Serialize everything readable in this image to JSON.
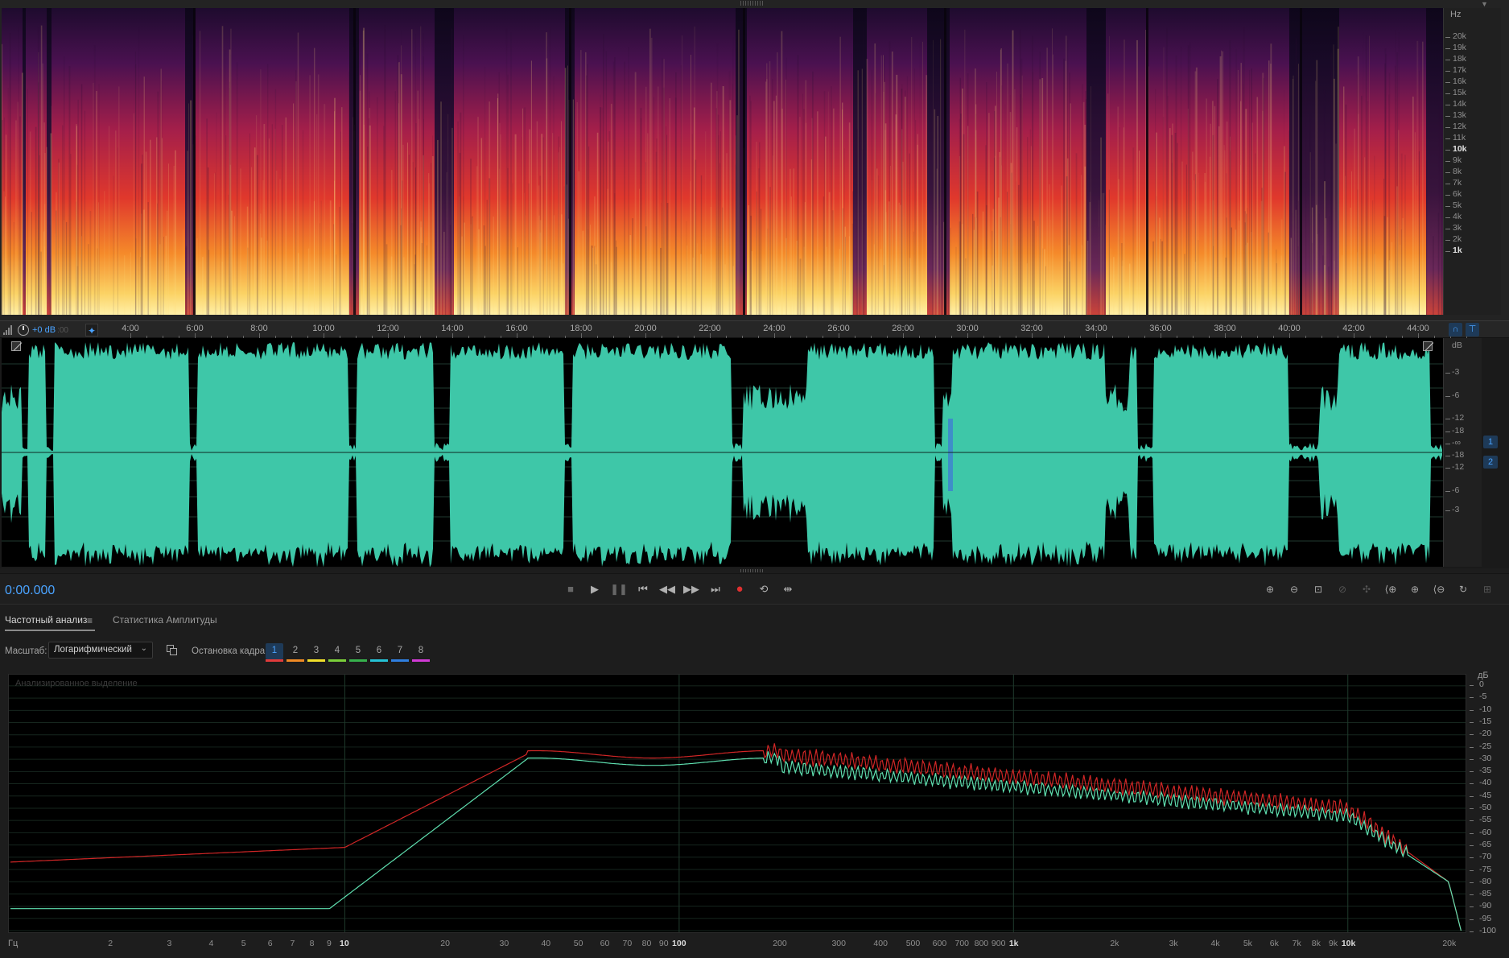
{
  "spectral": {
    "hz_unit": "Hz",
    "hz_labels": [
      "20k",
      "19k",
      "18k",
      "17k",
      "16k",
      "15k",
      "14k",
      "13k",
      "12k",
      "11k",
      "10k",
      "9k",
      "8k",
      "7k",
      "6k",
      "5k",
      "4k",
      "3k",
      "2k",
      "1k"
    ]
  },
  "time_ruler": {
    "gain_label": "+0 dB",
    "gain_ghost": ":00",
    "labels": [
      "4:00",
      "6:00",
      "8:00",
      "10:00",
      "12:00",
      "14:00",
      "16:00",
      "18:00",
      "20:00",
      "22:00",
      "24:00",
      "26:00",
      "28:00",
      "30:00",
      "32:00",
      "34:00",
      "36:00",
      "38:00",
      "40:00",
      "42:00",
      "44:00"
    ]
  },
  "waveform": {
    "db_unit": "dB",
    "db_labels": [
      "-3",
      "-6",
      "-12",
      "-18",
      "-∞",
      "-18",
      "-12",
      "-6",
      "-3"
    ],
    "channels": [
      "1",
      "2"
    ],
    "colors": {
      "wave": "#3ec7a8",
      "background": "#000000",
      "gap_highlight": "#3f7fd0"
    }
  },
  "transport": {
    "current_time": "0:00.000",
    "buttons": [
      "stop",
      "play",
      "pause",
      "go-to-start",
      "rewind",
      "fast-forward",
      "go-to-end",
      "record",
      "loop",
      "skip-selection"
    ],
    "zoom_buttons": [
      "zoom-in-amplitude",
      "zoom-out-amplitude",
      "zoom-to-selection",
      "zoom-out-full-disabled",
      "zoom-selection-disabled",
      "zoom-in-left",
      "zoom-in-time",
      "zoom-out-time",
      "zoom-full",
      "zoom-reset-disabled"
    ]
  },
  "analysis": {
    "tabs": [
      "Частотный анализ",
      "Статистика Амплитуды"
    ],
    "scale_label": "Масштаб:",
    "scale_value": "Логарифмический",
    "freeze_label": "Остановка кадра:",
    "frames": [
      "1",
      "2",
      "3",
      "4",
      "5",
      "6",
      "7",
      "8"
    ],
    "frame_colors": [
      "#e23b3b",
      "#f08a24",
      "#f2e02a",
      "#7bd03a",
      "#37b24d",
      "#25c3d6",
      "#2f7fe0",
      "#d23ad6"
    ],
    "plot_hint": "Анализированное выделение",
    "db_title": "дБ",
    "db_labels": [
      "0",
      "-5",
      "-10",
      "-15",
      "-20",
      "-25",
      "-30",
      "-35",
      "-40",
      "-45",
      "-50",
      "-55",
      "-60",
      "-65",
      "-70",
      "-75",
      "-80",
      "-85",
      "-90",
      "-95",
      "-100"
    ],
    "freq_unit": "Гц",
    "freq_labels": [
      {
        "t": "2",
        "f": 2
      },
      {
        "t": "3",
        "f": 3
      },
      {
        "t": "4",
        "f": 4
      },
      {
        "t": "5",
        "f": 5
      },
      {
        "t": "6",
        "f": 6
      },
      {
        "t": "7",
        "f": 7
      },
      {
        "t": "8",
        "f": 8
      },
      {
        "t": "9",
        "f": 9
      },
      {
        "t": "10",
        "f": 10,
        "major": true
      },
      {
        "t": "20",
        "f": 20
      },
      {
        "t": "30",
        "f": 30
      },
      {
        "t": "40",
        "f": 40
      },
      {
        "t": "50",
        "f": 50
      },
      {
        "t": "60",
        "f": 60
      },
      {
        "t": "70",
        "f": 70
      },
      {
        "t": "80",
        "f": 80
      },
      {
        "t": "90",
        "f": 90
      },
      {
        "t": "100",
        "f": 100,
        "major": true
      },
      {
        "t": "200",
        "f": 200
      },
      {
        "t": "300",
        "f": 300
      },
      {
        "t": "400",
        "f": 400
      },
      {
        "t": "500",
        "f": 500
      },
      {
        "t": "600",
        "f": 600
      },
      {
        "t": "700",
        "f": 700
      },
      {
        "t": "800",
        "f": 800
      },
      {
        "t": "900",
        "f": 900
      },
      {
        "t": "1k",
        "f": 1000,
        "major": true
      },
      {
        "t": "2k",
        "f": 2000
      },
      {
        "t": "3k",
        "f": 3000
      },
      {
        "t": "4k",
        "f": 4000
      },
      {
        "t": "5k",
        "f": 5000
      },
      {
        "t": "6k",
        "f": 6000
      },
      {
        "t": "7k",
        "f": 7000
      },
      {
        "t": "8k",
        "f": 8000
      },
      {
        "t": "9k",
        "f": 9000
      },
      {
        "t": "10k",
        "f": 10000,
        "major": true
      },
      {
        "t": "20k",
        "f": 20000
      }
    ],
    "curve_colors": {
      "left": "#d02626",
      "right": "#5fe0b0"
    }
  }
}
